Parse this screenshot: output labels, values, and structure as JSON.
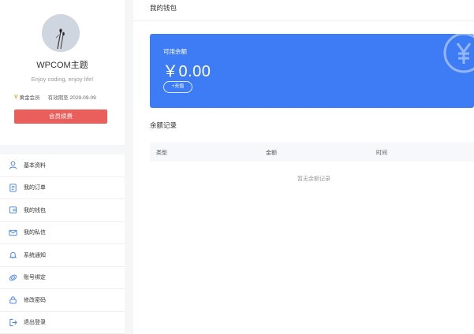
{
  "profile": {
    "username": "WPCOM主题",
    "motto": "Enjoy coding, enjoy life!",
    "vip_icon": "V",
    "vip_label": "黄金会员",
    "expire_text": "有效期至 2029-09-09",
    "renew_button": "会员续费"
  },
  "menu": {
    "items": [
      {
        "label": "基本资料",
        "icon": "user-icon"
      },
      {
        "label": "我的订单",
        "icon": "order-icon"
      },
      {
        "label": "我的钱包",
        "icon": "wallet-icon"
      },
      {
        "label": "我的私信",
        "icon": "mail-icon"
      },
      {
        "label": "系统通知",
        "icon": "bell-icon"
      },
      {
        "label": "账号绑定",
        "icon": "link-icon"
      },
      {
        "label": "修改密码",
        "icon": "lock-icon"
      },
      {
        "label": "退出登录",
        "icon": "logout-icon"
      }
    ]
  },
  "main": {
    "title": "我的钱包",
    "balance_label": "可用余额",
    "balance_amount": "￥0.00",
    "recharge_button": "+充值",
    "records_title": "余额记录",
    "columns": [
      "类型",
      "金额",
      "时间"
    ],
    "empty_text": "暂无余额记录"
  },
  "colors": {
    "accent": "#3d7cf5",
    "renew": "#ea5f5b",
    "vip": "#f0a020"
  }
}
